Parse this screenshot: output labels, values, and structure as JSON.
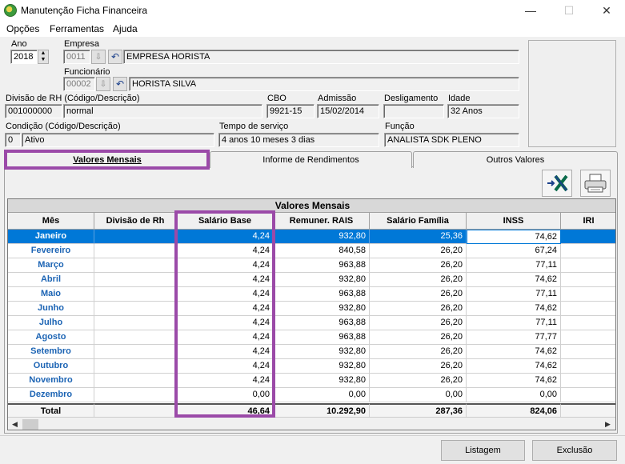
{
  "window": {
    "title": "Manutenção Ficha Financeira",
    "minimize": "—",
    "maximize": "☐",
    "close": "✕"
  },
  "menu": {
    "items": [
      "Opções",
      "Ferramentas",
      "Ajuda"
    ]
  },
  "form": {
    "ano_label": "Ano",
    "ano_value": "2018",
    "empresa_label": "Empresa",
    "empresa_code": "0011",
    "empresa_name": "EMPRESA HORISTA",
    "funcionario_label": "Funcionário",
    "funcionario_code": "00002",
    "funcionario_name": "HORISTA SILVA",
    "divisao_label": "Divisão de RH (Código/Descrição)",
    "divisao_code": "001000000",
    "divisao_desc": "normal",
    "cbo_label": "CBO",
    "cbo_value": "9921-15",
    "admissao_label": "Admissão",
    "admissao_value": "15/02/2014",
    "desligamento_label": "Desligamento",
    "desligamento_value": "",
    "idade_label": "Idade",
    "idade_value": "32 Anos",
    "condicao_label": "Condição (Código/Descrição)",
    "condicao_code": "0",
    "condicao_desc": "Ativo",
    "tempo_label": "Tempo de serviço",
    "tempo_value": "4 anos 10 meses 3 dias",
    "funcao_label": "Função",
    "funcao_value": "ANALISTA SDK PLENO"
  },
  "tabs": [
    {
      "label": "Valores Mensais",
      "active": true
    },
    {
      "label": "Informe de Rendimentos",
      "active": false
    },
    {
      "label": "Outros Valores",
      "active": false
    }
  ],
  "grid": {
    "title": "Valores Mensais",
    "columns": [
      "Mês",
      "Divisão de Rh",
      "Salário Base",
      "Remuner. RAIS",
      "Salário Família",
      "INSS",
      "IRI"
    ],
    "rows": [
      {
        "mes": "Janeiro",
        "divisao": "",
        "salario": "4,24",
        "rais": "932,80",
        "familia": "25,36",
        "inss": "74,62"
      },
      {
        "mes": "Fevereiro",
        "divisao": "",
        "salario": "4,24",
        "rais": "840,58",
        "familia": "26,20",
        "inss": "67,24"
      },
      {
        "mes": "Março",
        "divisao": "",
        "salario": "4,24",
        "rais": "963,88",
        "familia": "26,20",
        "inss": "77,11"
      },
      {
        "mes": "Abril",
        "divisao": "",
        "salario": "4,24",
        "rais": "932,80",
        "familia": "26,20",
        "inss": "74,62"
      },
      {
        "mes": "Maio",
        "divisao": "",
        "salario": "4,24",
        "rais": "963,88",
        "familia": "26,20",
        "inss": "77,11"
      },
      {
        "mes": "Junho",
        "divisao": "",
        "salario": "4,24",
        "rais": "932,80",
        "familia": "26,20",
        "inss": "74,62"
      },
      {
        "mes": "Julho",
        "divisao": "",
        "salario": "4,24",
        "rais": "963,88",
        "familia": "26,20",
        "inss": "77,11"
      },
      {
        "mes": "Agosto",
        "divisao": "",
        "salario": "4,24",
        "rais": "963,88",
        "familia": "26,20",
        "inss": "77,77"
      },
      {
        "mes": "Setembro",
        "divisao": "",
        "salario": "4,24",
        "rais": "932,80",
        "familia": "26,20",
        "inss": "74,62"
      },
      {
        "mes": "Outubro",
        "divisao": "",
        "salario": "4,24",
        "rais": "932,80",
        "familia": "26,20",
        "inss": "74,62"
      },
      {
        "mes": "Novembro",
        "divisao": "",
        "salario": "4,24",
        "rais": "932,80",
        "familia": "26,20",
        "inss": "74,62"
      },
      {
        "mes": "Dezembro",
        "divisao": "",
        "salario": "0,00",
        "rais": "0,00",
        "familia": "0,00",
        "inss": "0,00"
      }
    ],
    "total": {
      "mes": "Total",
      "divisao": "",
      "salario": "46,64",
      "rais": "10.292,90",
      "familia": "287,36",
      "inss": "824,06"
    }
  },
  "buttons": {
    "listagem": "Listagem",
    "exclusao": "Exclusão"
  },
  "colors": {
    "selection": "#0078d7",
    "month_text": "#1c64b4",
    "highlight": "#9b4aa8"
  }
}
